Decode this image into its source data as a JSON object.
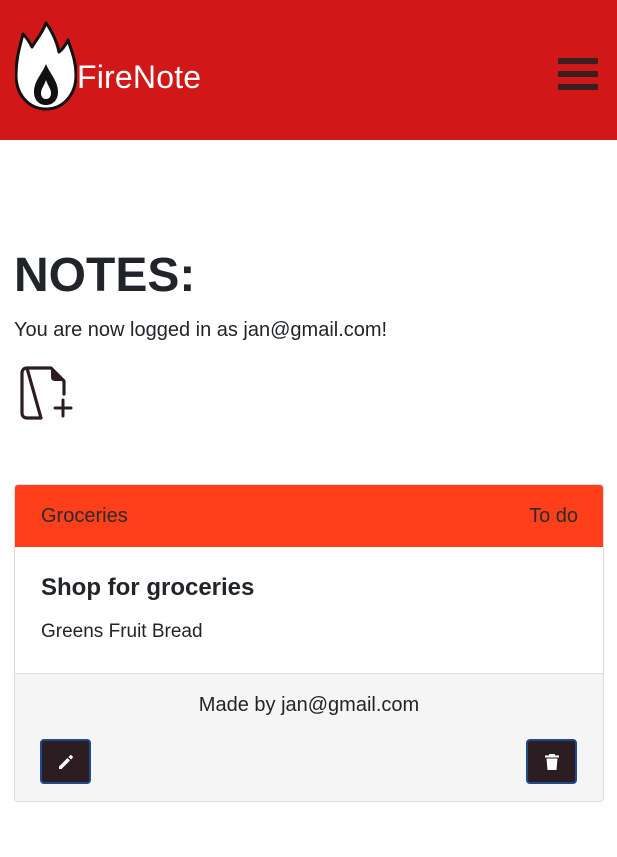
{
  "navbar": {
    "brand": "FireNote",
    "logo_icon": "flame-logo-icon",
    "menu_icon": "hamburger-menu-icon"
  },
  "main": {
    "title": "NOTES:",
    "login_message": "You are now logged in as jan@gmail.com!",
    "add_note_icon": "file-plus-icon"
  },
  "note": {
    "category": "Groceries",
    "status": "To do",
    "title": "Shop for groceries",
    "text": "Greens Fruit Bread",
    "author": "Made by jan@gmail.com",
    "edit_icon": "pencil-icon",
    "delete_icon": "trash-icon"
  },
  "colors": {
    "navbar_bg": "#d11718",
    "card_header_bg": "#ff3f1a",
    "button_bg": "#2b1d22",
    "footer_bg": "#f5f5f5"
  }
}
